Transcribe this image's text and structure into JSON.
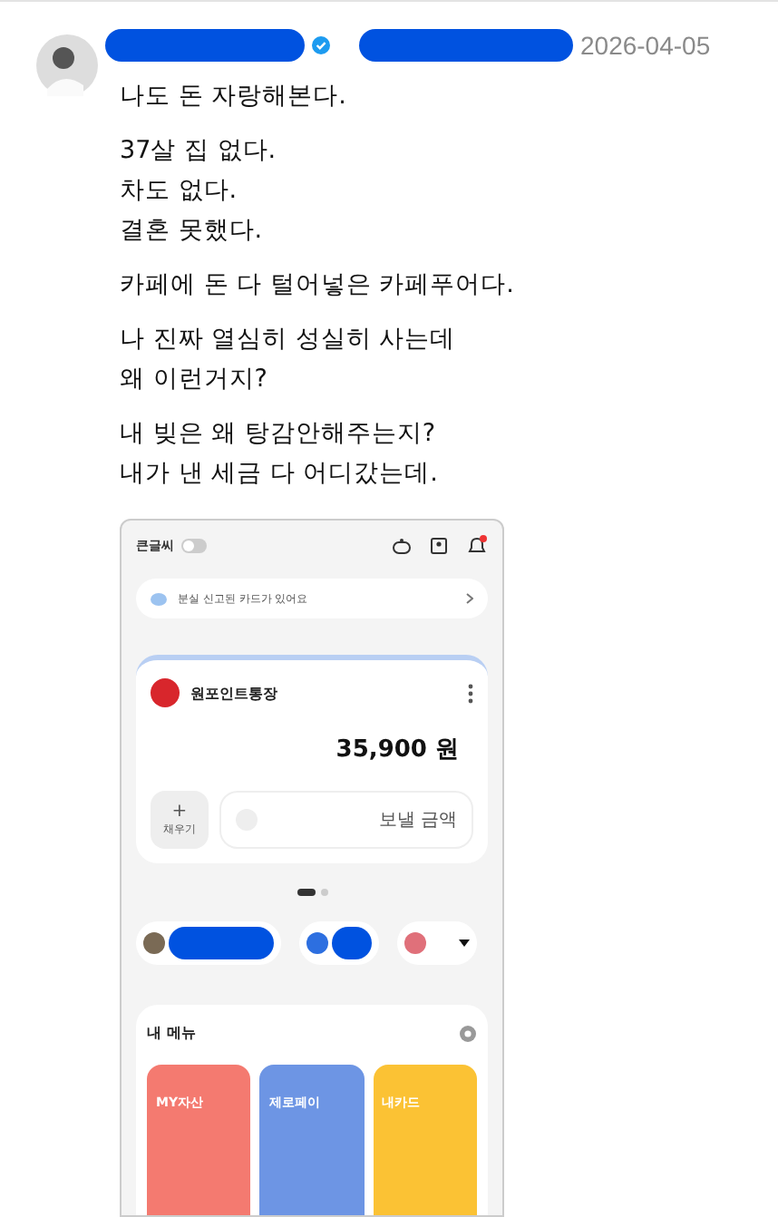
{
  "post": {
    "date": "2026-04-05",
    "verified": true,
    "paragraphs": [
      [
        "나도 돈 자랑해본다."
      ],
      [
        "37살 집 없다.",
        "차도 없다.",
        "결혼 못했다."
      ],
      [
        "카페에 돈 다 털어넣은 카페푸어다."
      ],
      [
        "나 진짜 열심히 성실히 사는데",
        "왜 이런거지?"
      ],
      [
        "내 빚은 왜 탕감안해주는지?",
        "내가 낸 세금 다 어디갔는데."
      ]
    ]
  },
  "app": {
    "large_text": {
      "label": "큰글씨",
      "on": false
    },
    "notice": "분실 신고된 카드가 있어요",
    "account": {
      "name": "원포인트통장",
      "balance": "35,900 원",
      "refill_icon": "+",
      "refill_label": "채우기",
      "amount_placeholder": "보낼 금액"
    },
    "pager": [
      {
        "selected": true
      },
      {
        "selected": false
      }
    ],
    "menu": {
      "title": "내 메뉴",
      "tiles": [
        {
          "label": "MY자산",
          "color": "#f47a70"
        },
        {
          "label": "제로페이",
          "color": "#6d95e4"
        },
        {
          "label": "내카드",
          "color": "#fbc234"
        }
      ]
    }
  }
}
